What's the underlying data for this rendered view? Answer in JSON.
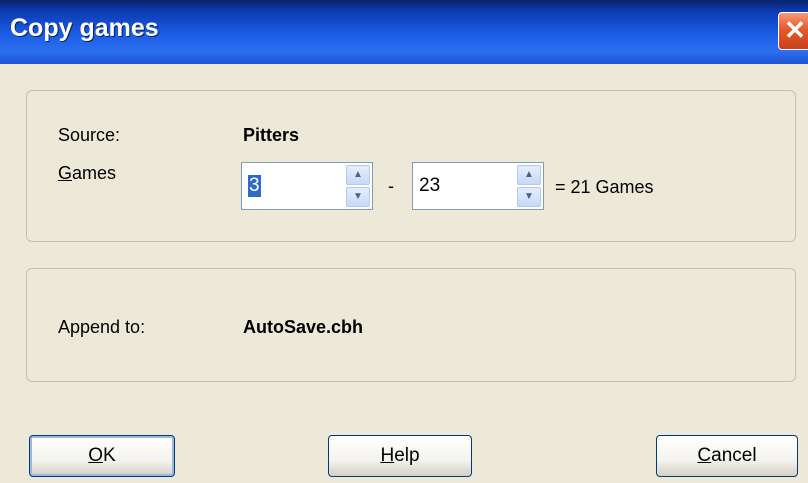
{
  "window": {
    "title": "Copy games",
    "close_glyph": "✕"
  },
  "source_group": {
    "source_label": "Source:",
    "source_value": "Pitters",
    "games_label_accel": "G",
    "games_label_rest": "ames",
    "range_start": "3",
    "range_sep": "-",
    "range_end": "23",
    "result": "= 21 Games"
  },
  "append_group": {
    "append_label": "Append to:",
    "append_value": "AutoSave.cbh"
  },
  "buttons": {
    "ok": {
      "accel": "O",
      "rest": "K"
    },
    "help": {
      "accel": "H",
      "rest": "elp"
    },
    "cancel": {
      "accel": "C",
      "rest": "ancel"
    }
  },
  "icons": {
    "spin_up": "▲",
    "spin_down": "▼"
  }
}
